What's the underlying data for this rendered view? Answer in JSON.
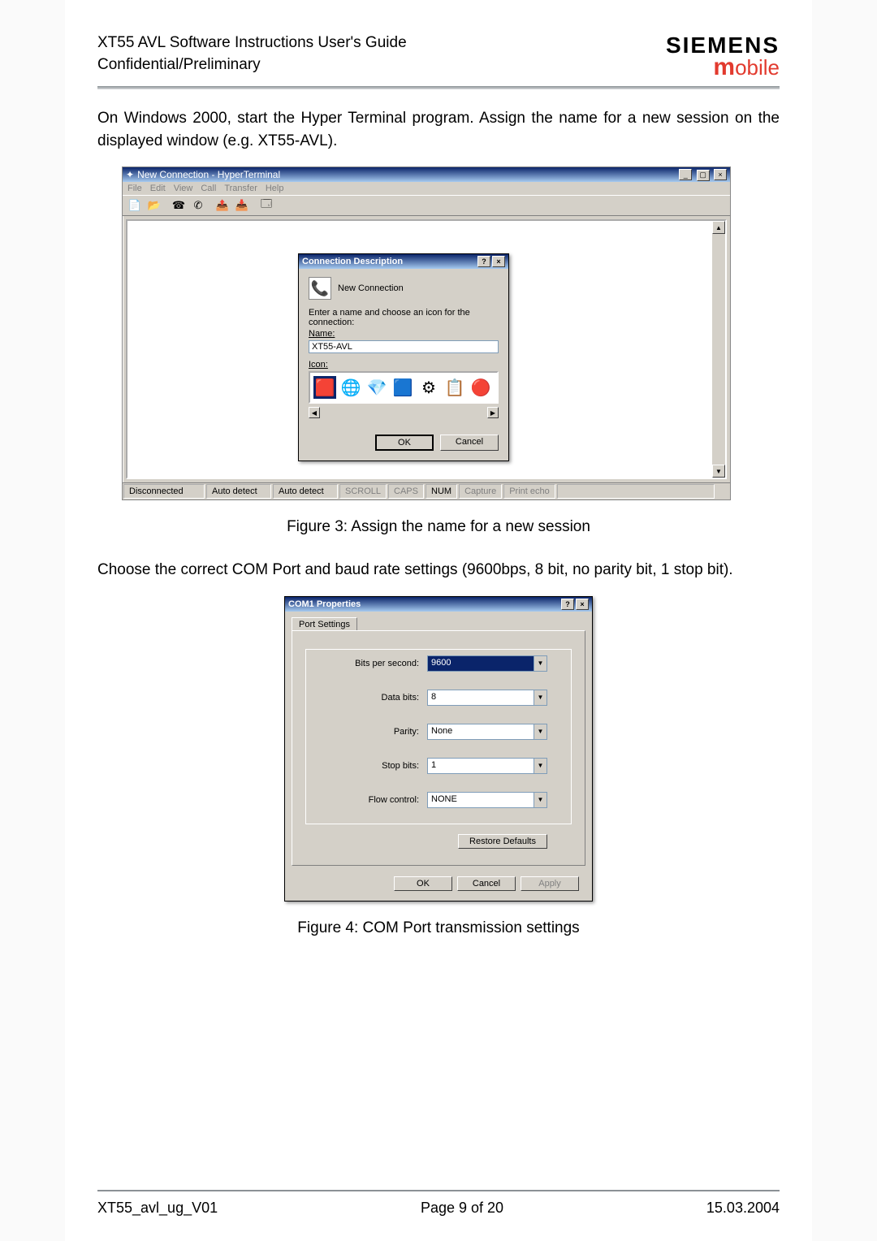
{
  "header": {
    "title_line1": "XT55 AVL Software Instructions User's Guide",
    "title_line2": "Confidential/Preliminary",
    "brand1": "SIEMENS",
    "brand2_m": "m",
    "brand2_rest": "obile"
  },
  "body": {
    "p1": "On Windows 2000, start the Hyper Terminal program. Assign the name for a new session on the displayed window (e.g. XT55-AVL).",
    "caption1": "Figure 3: Assign the name for a new session",
    "p2": "Choose the correct COM Port and baud rate settings (9600bps, 8 bit, no parity bit, 1 stop bit).",
    "caption2": "Figure 4: COM Port transmission settings"
  },
  "hyperterm": {
    "title": "New Connection - HyperTerminal",
    "menu": [
      "File",
      "Edit",
      "View",
      "Call",
      "Transfer",
      "Help"
    ],
    "status": {
      "conn": "Disconnected",
      "detect1": "Auto detect",
      "detect2": "Auto detect",
      "scroll": "SCROLL",
      "caps": "CAPS",
      "num": "NUM",
      "capture": "Capture",
      "echo": "Print echo"
    }
  },
  "conn_dialog": {
    "title": "Connection Description",
    "heading": "New Connection",
    "prompt": "Enter a name and choose an icon for the connection:",
    "name_label": "Name:",
    "name_value": "XT55-AVL",
    "icon_label": "Icon:",
    "ok": "OK",
    "cancel": "Cancel"
  },
  "com_dialog": {
    "title": "COM1 Properties",
    "tab": "Port Settings",
    "fields": {
      "bps_label": "Bits per second:",
      "bps_value": "9600",
      "data_label": "Data bits:",
      "data_value": "8",
      "parity_label": "Parity:",
      "parity_value": "None",
      "stop_label": "Stop bits:",
      "stop_value": "1",
      "flow_label": "Flow control:",
      "flow_value": "NONE"
    },
    "restore": "Restore Defaults",
    "ok": "OK",
    "cancel": "Cancel",
    "apply": "Apply"
  },
  "chart_data": {
    "type": "table",
    "title": "COM Port settings",
    "rows": [
      {
        "parameter": "Bits per second",
        "value": "9600"
      },
      {
        "parameter": "Data bits",
        "value": "8"
      },
      {
        "parameter": "Parity",
        "value": "None"
      },
      {
        "parameter": "Stop bits",
        "value": "1"
      },
      {
        "parameter": "Flow control",
        "value": "NONE"
      }
    ]
  },
  "footer": {
    "left": "XT55_avl_ug_V01",
    "center": "Page 9 of 20",
    "right": "15.03.2004"
  }
}
